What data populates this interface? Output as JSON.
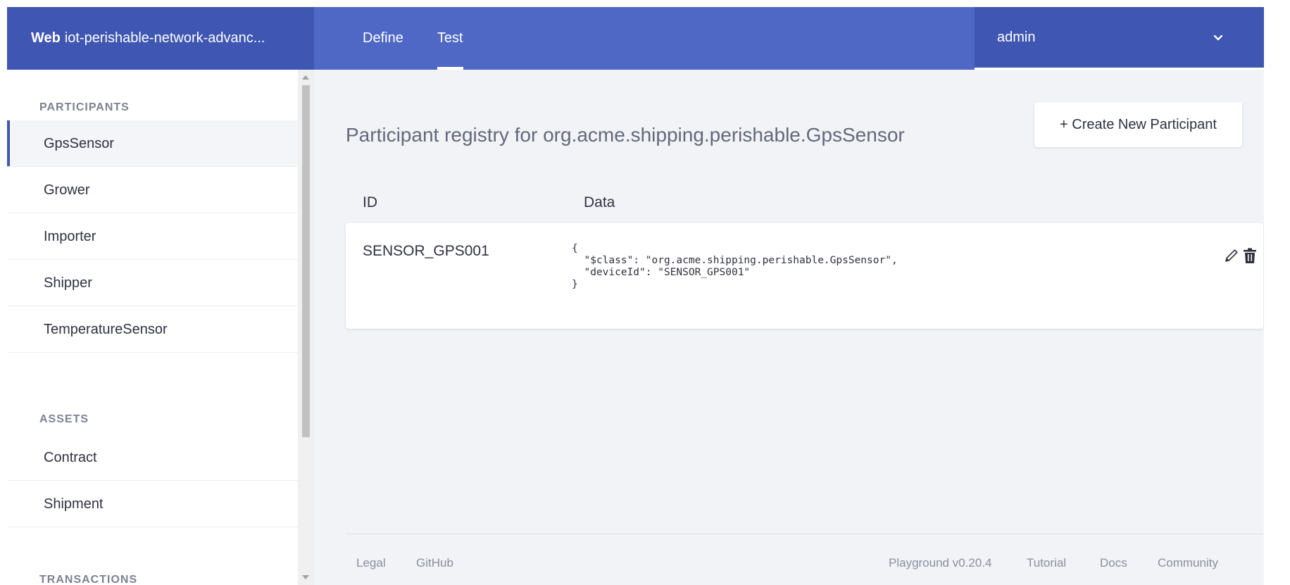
{
  "header": {
    "brand_bold": "Web",
    "brand_name": "iot-perishable-network-advanc...",
    "tabs": [
      {
        "label": "Define"
      },
      {
        "label": "Test"
      }
    ],
    "user": "admin"
  },
  "sidebar": {
    "participants_title": "PARTICIPANTS",
    "participants": [
      {
        "label": "GpsSensor"
      },
      {
        "label": "Grower"
      },
      {
        "label": "Importer"
      },
      {
        "label": "Shipper"
      },
      {
        "label": "TemperatureSensor"
      }
    ],
    "assets_title": "ASSETS",
    "assets": [
      {
        "label": "Contract"
      },
      {
        "label": "Shipment"
      }
    ],
    "transactions_title": "TRANSACTIONS"
  },
  "main": {
    "title": "Participant registry for org.acme.shipping.perishable.GpsSensor",
    "create_button": "+ Create New Participant",
    "columns": {
      "id": "ID",
      "data": "Data"
    },
    "rows": [
      {
        "id": "SENSOR_GPS001",
        "data": "{\n  \"$class\": \"org.acme.shipping.perishable.GpsSensor\",\n  \"deviceId\": \"SENSOR_GPS001\"\n}"
      }
    ]
  },
  "footer": {
    "legal": "Legal",
    "github": "GitHub",
    "version": "Playground v0.20.4",
    "tutorial": "Tutorial",
    "docs": "Docs",
    "community": "Community"
  },
  "icons": {
    "edit": "pencil-icon",
    "delete": "trash-icon",
    "user_menu": "chevron-down-icon"
  },
  "colors": {
    "header": "#4f67c5",
    "header_dark": "#3f56b2",
    "background": "#f2f3f7"
  }
}
